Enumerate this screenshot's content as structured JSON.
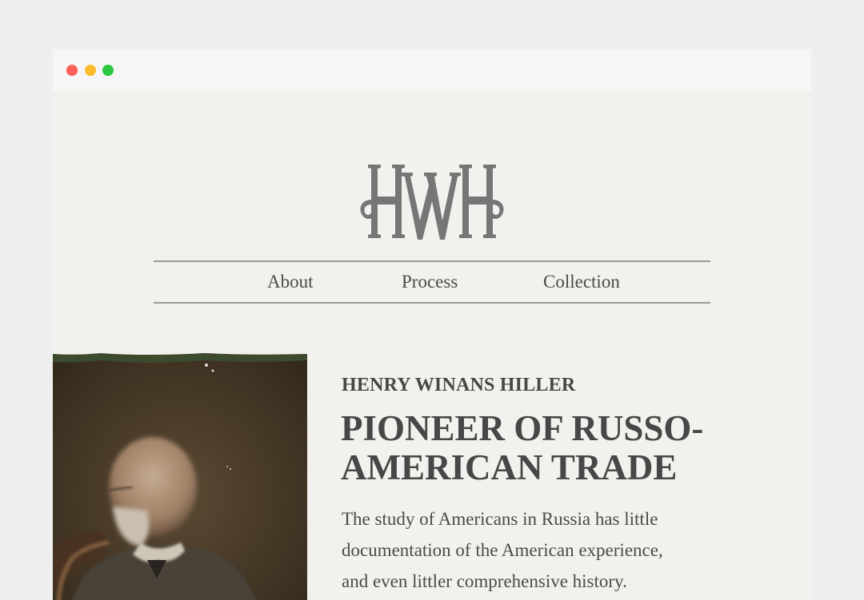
{
  "window": {
    "controls": [
      "close",
      "minimize",
      "maximize"
    ]
  },
  "logo": {
    "text": "HWH",
    "icon": "hwh-monogram-logo"
  },
  "nav": {
    "items": [
      {
        "label": "About"
      },
      {
        "label": "Process"
      },
      {
        "label": "Collection"
      }
    ]
  },
  "hero": {
    "image": "portrait of Henry Winans Hiller",
    "subtitle": "HENRY WINANS HILLER",
    "title": "PIONEER OF RUSSO-AMERICAN TRADE",
    "intro": "The study of Americans in Russia has little documentation of the American experience, and even littler comprehensive history."
  },
  "colors": {
    "background": "#f2f1ed",
    "text": "#474747",
    "rule": "#9a9a98",
    "logo": "#767676"
  }
}
